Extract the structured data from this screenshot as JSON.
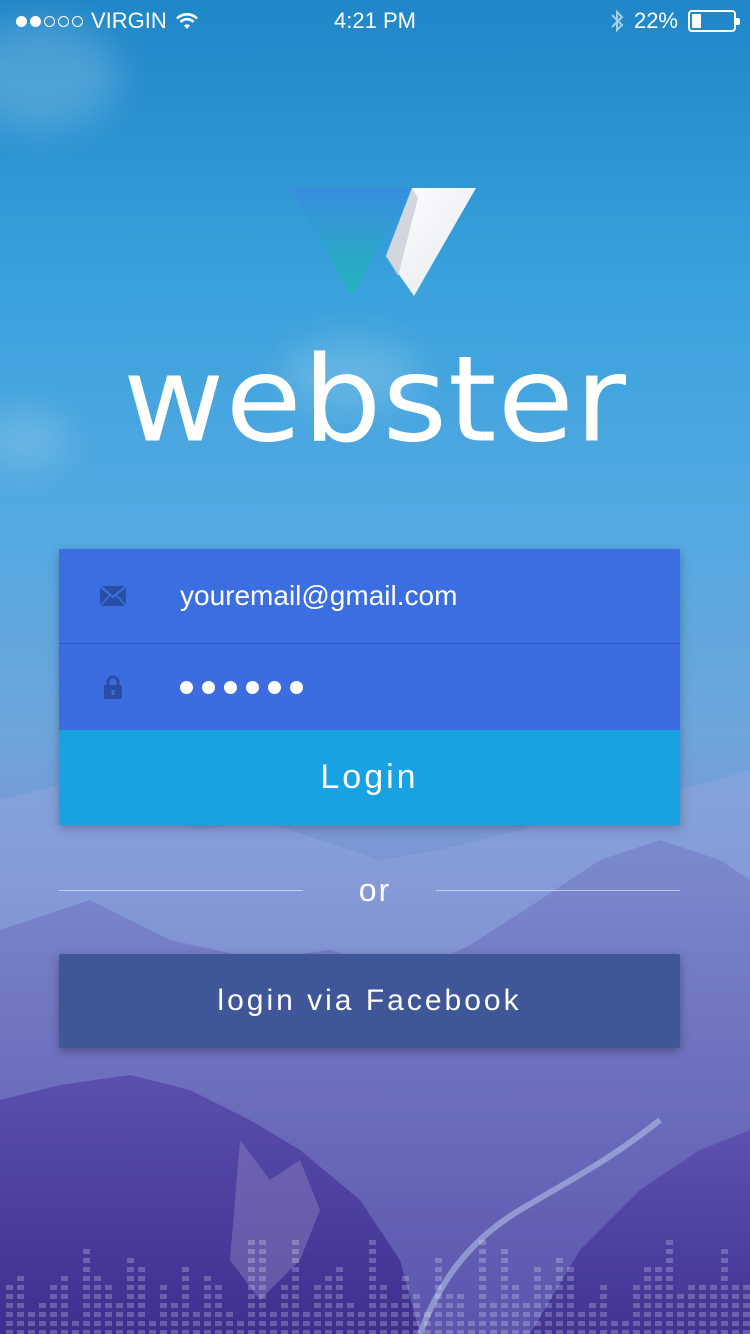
{
  "status_bar": {
    "carrier": "VIRGIN",
    "time": "4:21 PM",
    "battery_percent": "22%",
    "battery_level": 0.22,
    "signal_strength": 2,
    "icons": [
      "wifi-icon",
      "bluetooth-icon",
      "battery-icon"
    ]
  },
  "brand": {
    "name": "webster",
    "logo_colors": [
      "#3aa3e6",
      "#1fb0c0",
      "#ffffff",
      "#d6d9de"
    ]
  },
  "login_form": {
    "email_value": "youremail@gmail.com",
    "email_icon": "envelope-icon",
    "password_length": 6,
    "password_icon": "lock-icon",
    "login_label": "Login"
  },
  "divider_text": "or",
  "facebook_button_label": "login via Facebook",
  "colors": {
    "field_bg": "#3b6ee0",
    "login_button": "#18a2e2",
    "facebook_button": "#3f5799"
  }
}
